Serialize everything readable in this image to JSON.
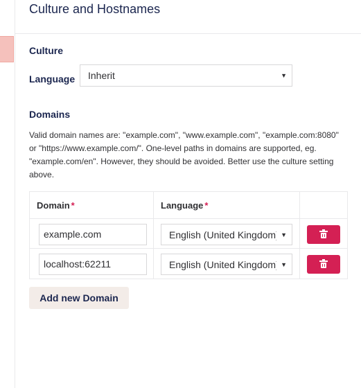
{
  "header": {
    "title": "Culture and Hostnames"
  },
  "culture": {
    "title": "Culture",
    "language_label": "Language",
    "language_value": "Inherit"
  },
  "domains": {
    "title": "Domains",
    "description": "Valid domain names are: \"example.com\", \"www.example.com\", \"example.com:8080\" or \"https://www.example.com/\". One-level paths in domains are supported, eg. \"example.com/en\". However, they should be avoided. Better use the culture setting above.",
    "columns": {
      "domain": "Domain",
      "language": "Language",
      "required_mark": "*"
    },
    "rows": [
      {
        "domain": "example.com",
        "language": "English (United Kingdom)"
      },
      {
        "domain": "localhost:62211",
        "language": "English (United Kingdom)"
      }
    ],
    "add_button": "Add new Domain"
  },
  "icons": {
    "delete": "trash-icon",
    "caret": "caret-down-icon"
  },
  "colors": {
    "danger": "#d42054",
    "text": "#1b264f",
    "add_button_bg": "#f3ece8",
    "rail_tab": "#f5c1bc"
  }
}
